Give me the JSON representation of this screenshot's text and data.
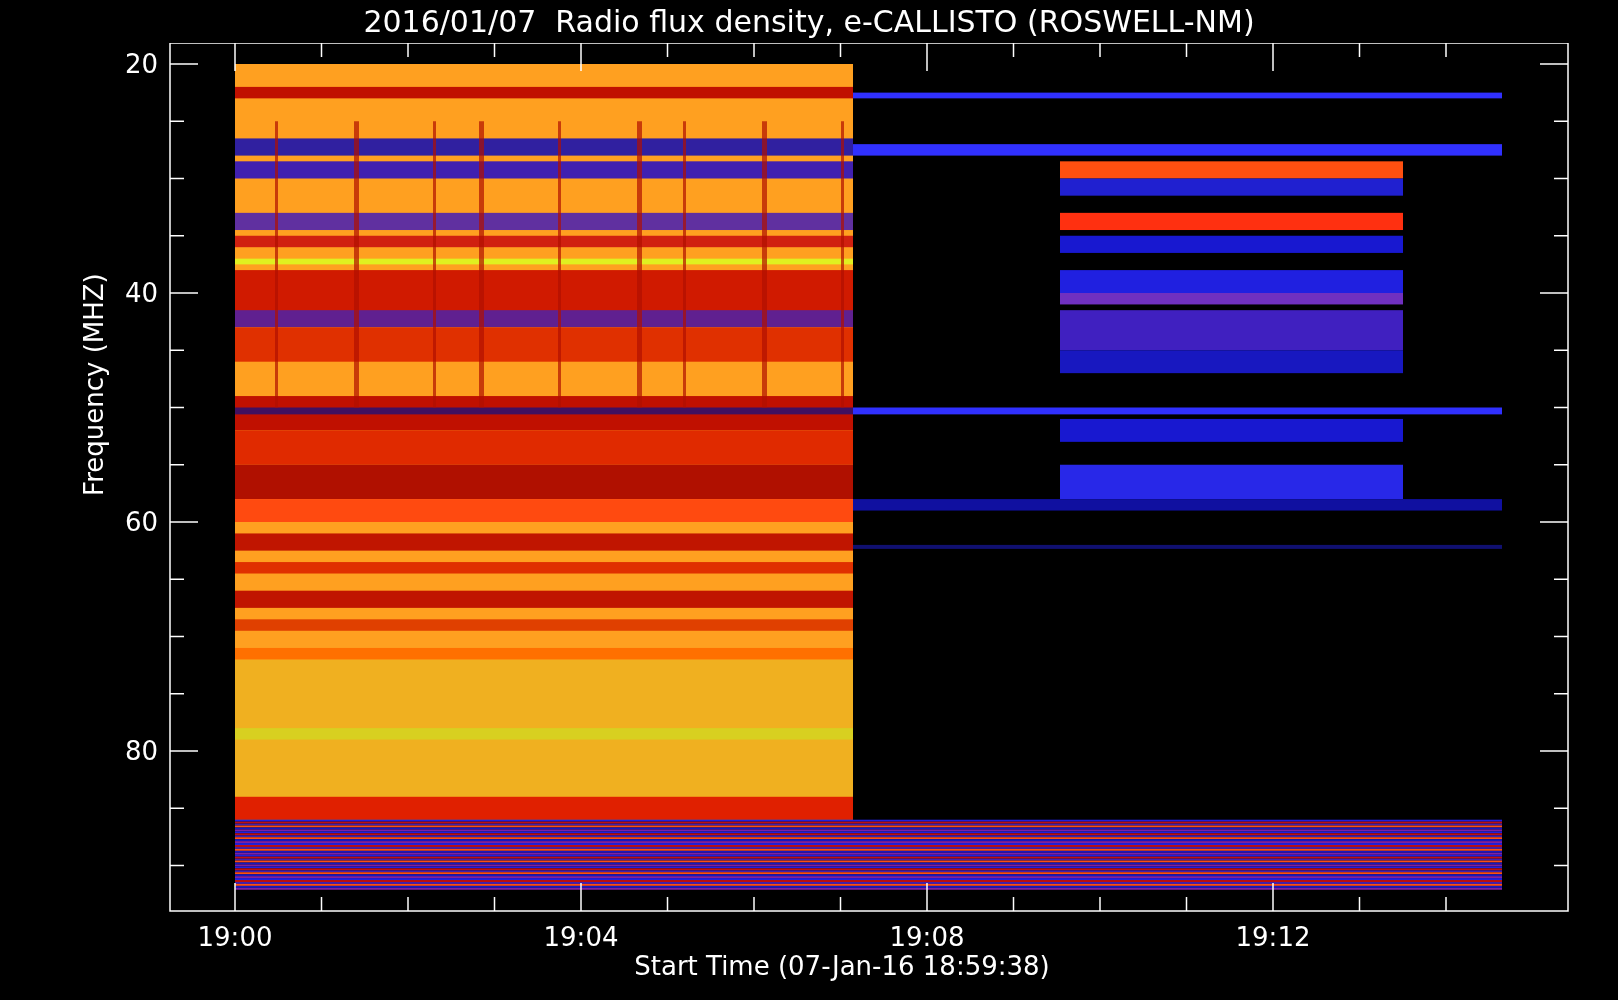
{
  "plot": {
    "title": "2016/01/07  Radio flux density, e-CALLISTO (ROSWELL-NM)",
    "ylabel": "Frequency (MHZ)",
    "yticks": [
      "20",
      "40",
      "60",
      "80"
    ],
    "xlabel": "Start Time (07-Jan-16 18:59:38)",
    "xticks": [
      "19:00",
      "19:04",
      "19:08",
      "19:12"
    ]
  }
}
